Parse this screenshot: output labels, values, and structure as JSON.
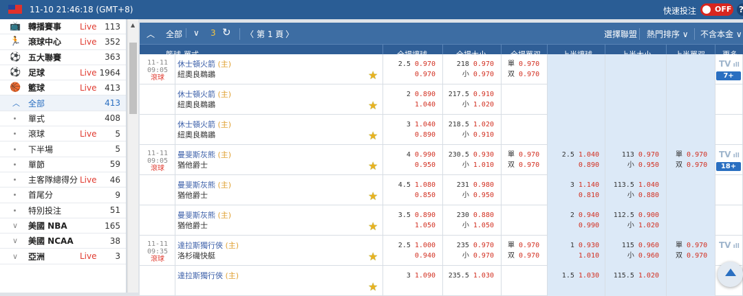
{
  "topbar": {
    "datetime": "11-10 21:46:18 (GMT+8)",
    "quick_bet_label": "快速投注",
    "toggle": "OFF",
    "help": "?"
  },
  "sidebar": [
    {
      "label": "轉播賽事",
      "live": "Live",
      "count": "113",
      "icon": "tv-icon"
    },
    {
      "label": "滾球中心",
      "live": "Live",
      "count": "352",
      "icon": "running-icon"
    },
    {
      "label": "五大聯賽",
      "live": "",
      "count": "363",
      "icon": "ball-icon"
    },
    {
      "label": "足球",
      "live": "Live",
      "count": "1964",
      "icon": "soccer-icon"
    },
    {
      "label": "籃球",
      "live": "Live",
      "count": "413",
      "icon": "basketball-icon"
    },
    {
      "label": "全部",
      "live": "",
      "count": "413",
      "kind": "active"
    },
    {
      "label": "單式",
      "live": "",
      "count": "408",
      "kind": "sub"
    },
    {
      "label": "滾球",
      "live": "Live",
      "count": "5",
      "kind": "sub"
    },
    {
      "label": "下半場",
      "live": "",
      "count": "5",
      "kind": "sub"
    },
    {
      "label": "單節",
      "live": "",
      "count": "59",
      "kind": "sub"
    },
    {
      "label": "主客隊總得分",
      "live": "Live",
      "count": "46",
      "kind": "sub"
    },
    {
      "label": "首尾分",
      "live": "",
      "count": "9",
      "kind": "sub"
    },
    {
      "label": "特別投注",
      "live": "",
      "count": "51",
      "kind": "sub"
    },
    {
      "label": "美國 NBA",
      "live": "",
      "count": "165",
      "kind": "league"
    },
    {
      "label": "美國 NCAA",
      "live": "",
      "count": "38",
      "kind": "league"
    },
    {
      "label": "亞洲",
      "live": "Live",
      "count": "3",
      "kind": "league"
    }
  ],
  "toolbar": {
    "all": "全部",
    "count": "3",
    "page": "第 1 頁",
    "select_league": "選擇聯盟",
    "sort": "熱門排序",
    "exclude_zero": "不含本金"
  },
  "columns": {
    "section": "籃球-單式",
    "ft_handicap": "全場讓球",
    "ft_ou": "全場大小",
    "ft_oe": "全場單双",
    "h1_handicap": "上半讓球",
    "h1_ou": "上半大小",
    "h1_oe": "上半單双",
    "more": "更多"
  },
  "rows": [
    {
      "date": "11-11",
      "time": "09:05",
      "status": "滾球",
      "home": "休士頓火箭",
      "home_tag": "(主)",
      "away": "紐奧良鵜鶘",
      "ft_hdp": "2.5",
      "ft_hdp_o1": "0.970",
      "ft_hdp_o2": "0.970",
      "ft_ou_line": "218",
      "ft_ou_o1": "0.970",
      "ft_ou_u": "小",
      "ft_ou_o2": "0.970",
      "oe1": "單",
      "oe1_o": "0.970",
      "oe2": "双",
      "oe2_o": "0.970",
      "h1_hdp": "",
      "h1_hdp_o1": "",
      "h1_hdp_o2": "",
      "h1_ou_line": "",
      "h1_ou_o1": "",
      "h1_ou_u": "",
      "h1_ou_o2": "",
      "h1oe1": "",
      "h1oe1_o": "",
      "h1oe2": "",
      "h1oe2_o": "",
      "tv": "TV",
      "more": "7+"
    },
    {
      "date": "",
      "time": "",
      "status": "",
      "home": "休士頓火箭",
      "home_tag": "(主)",
      "away": "紐奧良鵜鶘",
      "ft_hdp": "2",
      "ft_hdp_o1": "0.890",
      "ft_hdp_o2": "1.040",
      "ft_ou_line": "217.5",
      "ft_ou_o1": "0.910",
      "ft_ou_u": "小",
      "ft_ou_o2": "1.020",
      "oe1": "",
      "oe1_o": "",
      "oe2": "",
      "oe2_o": "",
      "h1_hdp": "",
      "h1_hdp_o1": "",
      "h1_hdp_o2": "",
      "h1_ou_line": "",
      "h1_ou_o1": "",
      "h1_ou_u": "",
      "h1_ou_o2": "",
      "h1oe1": "",
      "h1oe1_o": "",
      "h1oe2": "",
      "h1oe2_o": "",
      "tv": "",
      "more": ""
    },
    {
      "date": "",
      "time": "",
      "status": "",
      "home": "休士頓火箭",
      "home_tag": "(主)",
      "away": "紐奧良鵜鶘",
      "ft_hdp": "3",
      "ft_hdp_o1": "1.040",
      "ft_hdp_o2": "0.890",
      "ft_ou_line": "218.5",
      "ft_ou_o1": "1.020",
      "ft_ou_u": "小",
      "ft_ou_o2": "0.910",
      "oe1": "",
      "oe1_o": "",
      "oe2": "",
      "oe2_o": "",
      "h1_hdp": "",
      "h1_hdp_o1": "",
      "h1_hdp_o2": "",
      "h1_ou_line": "",
      "h1_ou_o1": "",
      "h1_ou_u": "",
      "h1_ou_o2": "",
      "h1oe1": "",
      "h1oe1_o": "",
      "h1oe2": "",
      "h1oe2_o": "",
      "tv": "",
      "more": ""
    },
    {
      "date": "11-11",
      "time": "09:05",
      "status": "滾球",
      "home": "曼斐斯灰熊",
      "home_tag": "(主)",
      "away": "猶他爵士",
      "ft_hdp": "4",
      "ft_hdp_o1": "0.990",
      "ft_hdp_o2": "0.950",
      "ft_ou_line": "230.5",
      "ft_ou_o1": "0.930",
      "ft_ou_u": "小",
      "ft_ou_o2": "1.010",
      "oe1": "單",
      "oe1_o": "0.970",
      "oe2": "双",
      "oe2_o": "0.970",
      "h1_hdp": "2.5",
      "h1_hdp_o1": "1.040",
      "h1_hdp_o2": "0.890",
      "h1_ou_line": "113",
      "h1_ou_o1": "0.970",
      "h1_ou_u": "小",
      "h1_ou_o2": "0.950",
      "h1oe1": "單",
      "h1oe1_o": "0.970",
      "h1oe2": "双",
      "h1oe2_o": "0.970",
      "tv": "TV",
      "more": "18+"
    },
    {
      "date": "",
      "time": "",
      "status": "",
      "home": "曼斐斯灰熊",
      "home_tag": "(主)",
      "away": "猶他爵士",
      "ft_hdp": "4.5",
      "ft_hdp_o1": "1.080",
      "ft_hdp_o2": "0.850",
      "ft_ou_line": "231",
      "ft_ou_o1": "0.980",
      "ft_ou_u": "小",
      "ft_ou_o2": "0.950",
      "oe1": "",
      "oe1_o": "",
      "oe2": "",
      "oe2_o": "",
      "h1_hdp": "3",
      "h1_hdp_o1": "1.140",
      "h1_hdp_o2": "0.810",
      "h1_ou_line": "113.5",
      "h1_ou_o1": "1.040",
      "h1_ou_u": "小",
      "h1_ou_o2": "0.880",
      "h1oe1": "",
      "h1oe1_o": "",
      "h1oe2": "",
      "h1oe2_o": "",
      "tv": "",
      "more": ""
    },
    {
      "date": "",
      "time": "",
      "status": "",
      "home": "曼斐斯灰熊",
      "home_tag": "(主)",
      "away": "猶他爵士",
      "ft_hdp": "3.5",
      "ft_hdp_o1": "0.890",
      "ft_hdp_o2": "1.050",
      "ft_ou_line": "230",
      "ft_ou_o1": "0.880",
      "ft_ou_u": "小",
      "ft_ou_o2": "1.050",
      "oe1": "",
      "oe1_o": "",
      "oe2": "",
      "oe2_o": "",
      "h1_hdp": "2",
      "h1_hdp_o1": "0.940",
      "h1_hdp_o2": "0.990",
      "h1_ou_line": "112.5",
      "h1_ou_o1": "0.900",
      "h1_ou_u": "小",
      "h1_ou_o2": "1.020",
      "h1oe1": "",
      "h1oe1_o": "",
      "h1oe2": "",
      "h1oe2_o": "",
      "tv": "",
      "more": ""
    },
    {
      "date": "11-11",
      "time": "09:35",
      "status": "滾球",
      "home": "達拉斯獨行俠",
      "home_tag": "(主)",
      "away": "洛杉磯快艇",
      "ft_hdp": "2.5",
      "ft_hdp_o1": "1.000",
      "ft_hdp_o2": "0.940",
      "ft_ou_line": "235",
      "ft_ou_o1": "0.970",
      "ft_ou_u": "小",
      "ft_ou_o2": "0.970",
      "oe1": "單",
      "oe1_o": "0.970",
      "oe2": "双",
      "oe2_o": "0.970",
      "h1_hdp": "1",
      "h1_hdp_o1": "0.930",
      "h1_hdp_o2": "1.010",
      "h1_ou_line": "115",
      "h1_ou_o1": "0.960",
      "h1_ou_u": "小",
      "h1_ou_o2": "0.960",
      "h1oe1": "單",
      "h1oe1_o": "0.970",
      "h1oe2": "双",
      "h1oe2_o": "0.970",
      "tv": "TV",
      "more": ""
    },
    {
      "date": "",
      "time": "",
      "status": "",
      "home": "達拉斯獨行俠",
      "home_tag": "(主)",
      "away": "",
      "ft_hdp": "3",
      "ft_hdp_o1": "1.090",
      "ft_hdp_o2": "",
      "ft_ou_line": "235.5",
      "ft_ou_o1": "1.030",
      "ft_ou_u": "",
      "ft_ou_o2": "",
      "oe1": "",
      "oe1_o": "",
      "oe2": "",
      "oe2_o": "",
      "h1_hdp": "1.5",
      "h1_hdp_o1": "1.030",
      "h1_hdp_o2": "",
      "h1_ou_line": "115.5",
      "h1_ou_o1": "1.020",
      "h1_ou_u": "",
      "h1_ou_o2": "",
      "h1oe1": "",
      "h1oe1_o": "",
      "h1oe2": "",
      "h1oe2_o": "",
      "tv": "",
      "more": ""
    }
  ]
}
